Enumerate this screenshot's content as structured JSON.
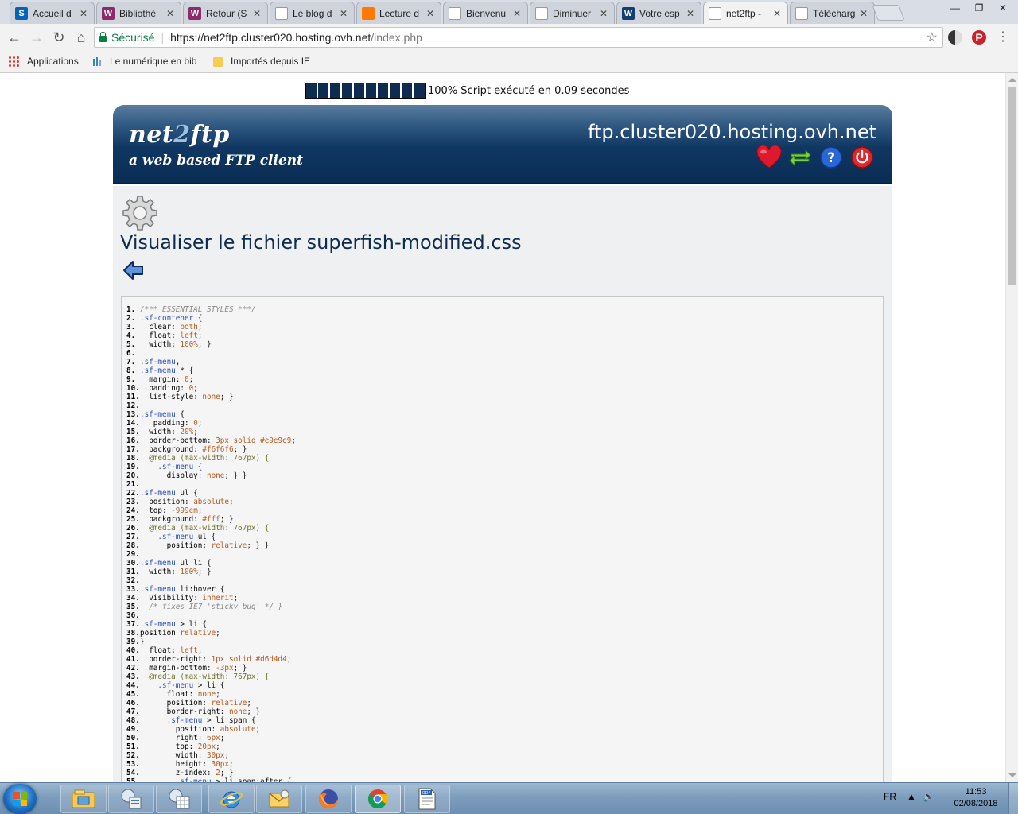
{
  "browser": {
    "tabs": [
      {
        "label": "Accueil d",
        "icon": "sharepoint-icon",
        "color": "#0364b8",
        "glyph": "S"
      },
      {
        "label": "Bibliothè",
        "icon": "library-icon",
        "color": "#8d2a6b",
        "glyph": "W"
      },
      {
        "label": "Retour (S",
        "icon": "library-icon",
        "color": "#8d2a6b",
        "glyph": "W"
      },
      {
        "label": "Le blog d",
        "icon": "page-icon",
        "color": "#ffffff",
        "glyph": ""
      },
      {
        "label": "Lecture d",
        "icon": "orange-icon",
        "color": "#ff7900",
        "glyph": ""
      },
      {
        "label": "Bienvenu",
        "icon": "site-icon",
        "color": "#ffffff",
        "glyph": ""
      },
      {
        "label": "Diminuer",
        "icon": "site-icon",
        "color": "#ffffff",
        "glyph": ""
      },
      {
        "label": "Votre esp",
        "icon": "ovh-icon",
        "color": "#123f6d",
        "glyph": "W"
      },
      {
        "label": "net2ftp -",
        "icon": "net2ftp-icon",
        "color": "#ffffff",
        "glyph": ""
      },
      {
        "label": "Télécharg",
        "icon": "download-icon",
        "color": "#ffffff",
        "glyph": ""
      }
    ],
    "active_tab": 8,
    "secure_label": "Sécurisé",
    "url_base": "https://net2ftp.cluster020.hosting.ovh.net",
    "url_path": "/index.php",
    "bookmarks": [
      {
        "label": "Applications",
        "icon": "apps-grid-icon"
      },
      {
        "label": "Le numérique en bib",
        "icon": "bookmark-site-icon"
      },
      {
        "label": "Importés depuis IE",
        "icon": "folder-icon"
      }
    ]
  },
  "page": {
    "progress_percent": 100,
    "progress_text": "100% Script exécuté en 0.09 secondes",
    "logo_main": "net",
    "logo_two": "2",
    "logo_end": "ftp",
    "tagline": "a web based FTP client",
    "host": "ftp.cluster020.hosting.ovh.net",
    "header_icons": [
      "heart-icon",
      "refresh-icon",
      "help-icon",
      "power-icon"
    ],
    "title": "Visualiser le fichier superfish-modified.css",
    "code_lines": [
      "/*** ESSENTIAL STYLES ***/",
      ".sf-contener {",
      "  clear: both;",
      "  float: left;",
      "  width: 100%; }",
      "",
      ".sf-menu,",
      ".sf-menu * {",
      "  margin: 0;",
      "  padding: 0;",
      "  list-style: none; }",
      "",
      ".sf-menu {",
      "   padding: 0;",
      "  width: 20%;",
      "  border-bottom: 3px solid #e9e9e9;",
      "  background: #f6f6f6; }",
      "  @media (max-width: 767px) {",
      "    .sf-menu {",
      "      display: none; } }",
      "",
      ".sf-menu ul {",
      "  position: absolute;",
      "  top: -999em;",
      "  background: #fff; }",
      "  @media (max-width: 767px) {",
      "    .sf-menu ul {",
      "      position: relative; } }",
      "",
      ".sf-menu ul li {",
      "  width: 100%; }",
      "",
      ".sf-menu li:hover {",
      "  visibility: inherit;",
      "  /* fixes IE7 'sticky bug' */ }",
      "",
      ".sf-menu > li {",
      "position relative;",
      "}",
      "  float: left;",
      "  border-right: 1px solid #d6d4d4;",
      "  margin-bottom: -3px; }",
      "  @media (max-width: 767px) {",
      "    .sf-menu > li {",
      "      float: none;",
      "      position: relative;",
      "      border-right: none; }",
      "      .sf-menu > li span {",
      "        position: absolute;",
      "        right: 6px;",
      "        top: 20px;",
      "        width: 30px;",
      "        height: 30px;",
      "        z-index: 2; }",
      "        .sf-menu > li span:after {"
    ]
  },
  "taskbar": {
    "apps": [
      {
        "name": "explorer-icon",
        "state": "pinned"
      },
      {
        "name": "network-icon",
        "state": "pinned"
      },
      {
        "name": "spreadsheet-icon",
        "state": "pinned"
      },
      {
        "name": "ie-icon",
        "state": "pinned"
      },
      {
        "name": "mail-icon",
        "state": "pinned"
      },
      {
        "name": "firefox-icon",
        "state": "pinned"
      },
      {
        "name": "chrome-icon",
        "state": "active"
      },
      {
        "name": "odf-icon",
        "state": "pinned"
      }
    ],
    "language": "FR",
    "time": "11:53",
    "date": "02/08/2018"
  }
}
